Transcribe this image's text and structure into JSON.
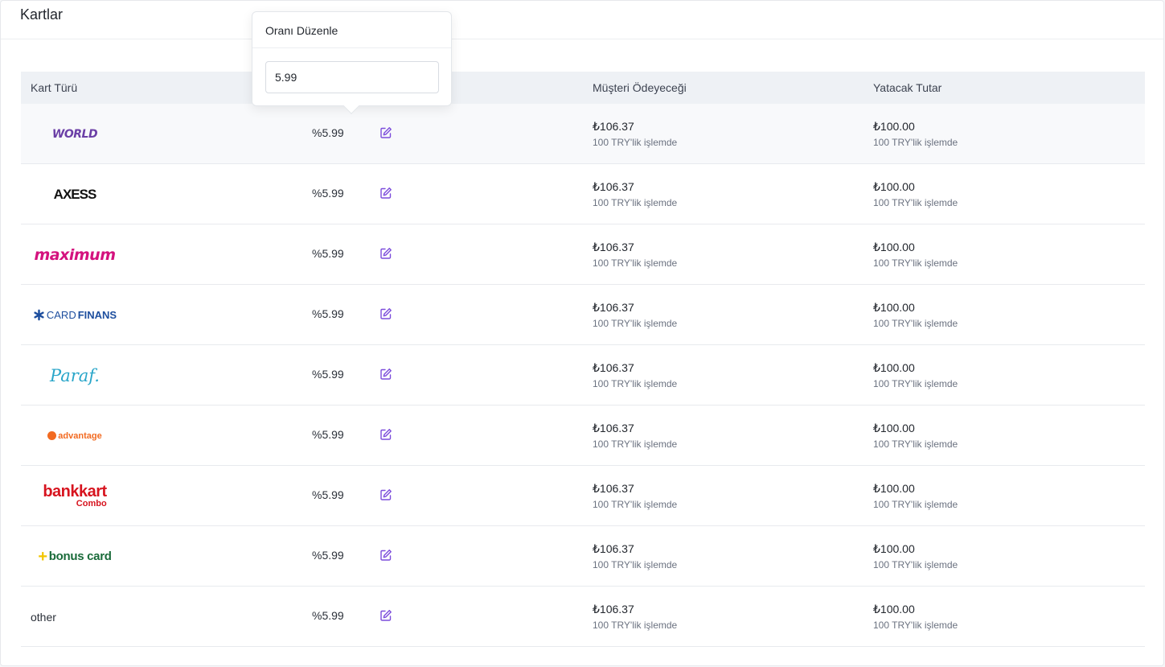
{
  "card": {
    "title": "Kartlar"
  },
  "table": {
    "headers": {
      "card_type": "Kart Türü",
      "customer_pays": "Müşteri Ödeyeceği",
      "deposit_amount": "Yatacak Tutar"
    },
    "rows": [
      {
        "logo": "WORLD",
        "rate": "%5.99",
        "pay": "₺106.37",
        "pay_note": "100 TRY'lik işlemde",
        "dep": "₺100.00",
        "dep_note": "100 TRY'lik işlemde"
      },
      {
        "logo": "AXESS",
        "rate": "%5.99",
        "pay": "₺106.37",
        "pay_note": "100 TRY'lik işlemde",
        "dep": "₺100.00",
        "dep_note": "100 TRY'lik işlemde"
      },
      {
        "logo": "maximum",
        "rate": "%5.99",
        "pay": "₺106.37",
        "pay_note": "100 TRY'lik işlemde",
        "dep": "₺100.00",
        "dep_note": "100 TRY'lik işlemde"
      },
      {
        "logo_prefix": "CARD",
        "logo": "FINANS",
        "rate": "%5.99",
        "pay": "₺106.37",
        "pay_note": "100 TRY'lik işlemde",
        "dep": "₺100.00",
        "dep_note": "100 TRY'lik işlemde"
      },
      {
        "logo": "Paraf.",
        "rate": "%5.99",
        "pay": "₺106.37",
        "pay_note": "100 TRY'lik işlemde",
        "dep": "₺100.00",
        "dep_note": "100 TRY'lik işlemde"
      },
      {
        "logo": "advantage",
        "rate": "%5.99",
        "pay": "₺106.37",
        "pay_note": "100 TRY'lik işlemde",
        "dep": "₺100.00",
        "dep_note": "100 TRY'lik işlemde"
      },
      {
        "logo": "bankkart",
        "logo_sub": "Combo",
        "rate": "%5.99",
        "pay": "₺106.37",
        "pay_note": "100 TRY'lik işlemde",
        "dep": "₺100.00",
        "dep_note": "100 TRY'lik işlemde"
      },
      {
        "logo": "bonus card",
        "rate": "%5.99",
        "pay": "₺106.37",
        "pay_note": "100 TRY'lik işlemde",
        "dep": "₺100.00",
        "dep_note": "100 TRY'lik işlemde"
      },
      {
        "label": "other",
        "rate": "%5.99",
        "pay": "₺106.37",
        "pay_note": "100 TRY'lik işlemde",
        "dep": "₺100.00",
        "dep_note": "100 TRY'lik işlemde"
      }
    ]
  },
  "popover": {
    "title": "Oranı Düzenle",
    "input_value": "5.99"
  },
  "icons": {
    "edit": "edit-icon"
  },
  "colors": {
    "accent": "#7c4ddb",
    "header_bg": "#eef1f5"
  }
}
